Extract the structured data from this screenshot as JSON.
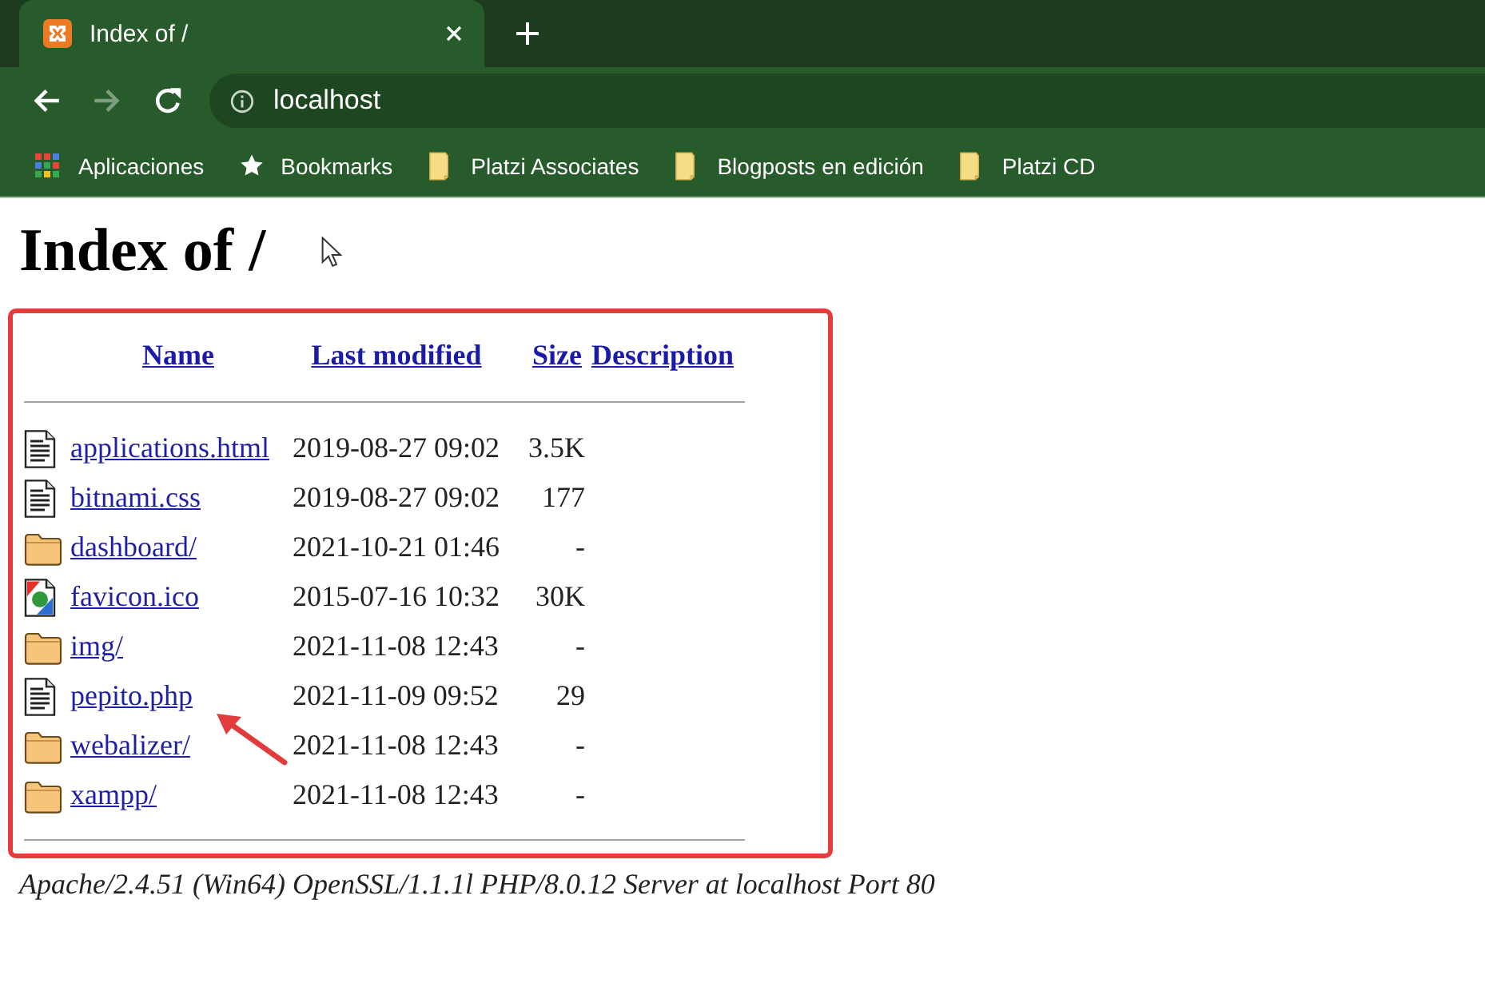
{
  "browser": {
    "tabs": [
      {
        "title": "Index of /",
        "selected": true
      }
    ],
    "nav_buttons": [
      {
        "kind": "back",
        "disabled": false
      },
      {
        "kind": "forward",
        "disabled": true
      },
      {
        "kind": "reload",
        "disabled": false
      }
    ],
    "address_bar": {
      "value": "localhost"
    },
    "bookmarks": [
      {
        "kind": "apps",
        "label": "Aplicaciones"
      },
      {
        "kind": "star",
        "label": "Bookmarks"
      },
      {
        "kind": "folder",
        "label": "Platzi Associates"
      },
      {
        "kind": "folder",
        "label": "Blogposts en edición"
      },
      {
        "kind": "folder",
        "label": "Platzi CD"
      }
    ]
  },
  "page": {
    "title": "Index of /",
    "cursor_visible": true,
    "listing": {
      "highlighted": true,
      "columns": [
        "Name",
        "Last modified",
        "Size",
        "Description"
      ],
      "rows": [
        {
          "kind": "file",
          "name": "applications.html",
          "modified": "2019-08-27 09:02",
          "size": "3.5K",
          "pointed": false
        },
        {
          "kind": "file",
          "name": "bitnami.css",
          "modified": "2019-08-27 09:02",
          "size": "177",
          "pointed": false
        },
        {
          "kind": "folder",
          "name": "dashboard/",
          "modified": "2021-10-21 01:46",
          "size": "-",
          "pointed": false
        },
        {
          "kind": "image",
          "name": "favicon.ico",
          "modified": "2015-07-16 10:32",
          "size": "30K",
          "pointed": false
        },
        {
          "kind": "folder",
          "name": "img/",
          "modified": "2021-11-08 12:43",
          "size": "-",
          "pointed": false
        },
        {
          "kind": "file",
          "name": "pepito.php",
          "modified": "2021-11-09 09:52",
          "size": "29",
          "pointed": true
        },
        {
          "kind": "folder",
          "name": "webalizer/",
          "modified": "2021-11-08 12:43",
          "size": "-",
          "pointed": false
        },
        {
          "kind": "folder",
          "name": "xampp/",
          "modified": "2021-11-08 12:43",
          "size": "-",
          "pointed": false
        }
      ]
    },
    "footer": "Apache/2.4.51 (Win64) OpenSSL/1.1.1l PHP/8.0.12 Server at localhost Port 80"
  }
}
